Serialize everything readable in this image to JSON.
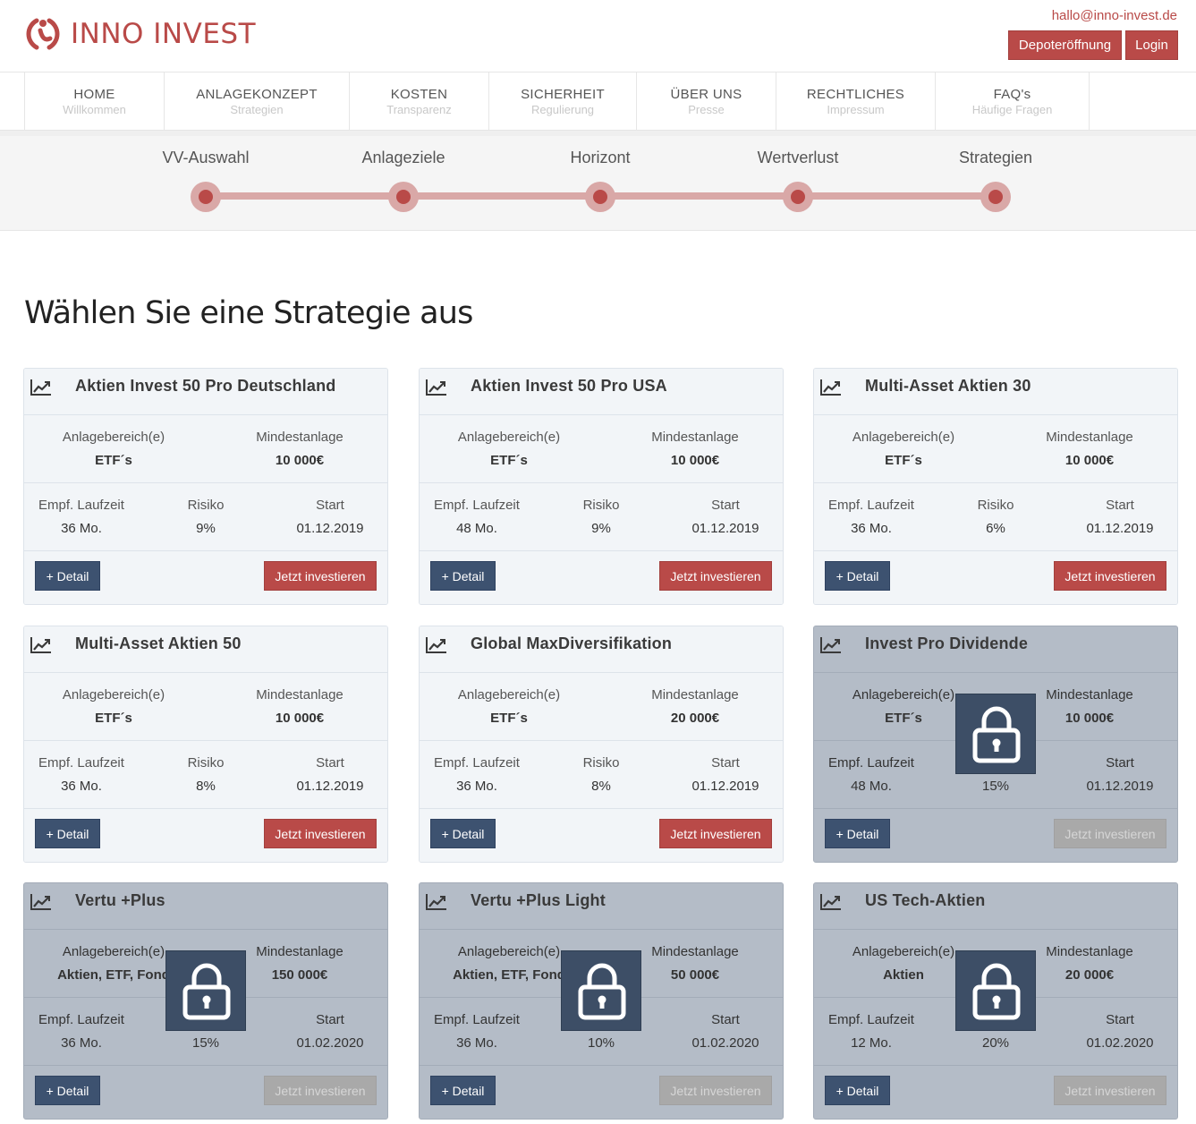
{
  "header": {
    "brand": "INNO INVEST",
    "email": "hallo@inno-invest.de",
    "depot_label": "Depoteröffnung",
    "login_label": "Login",
    "accent": "#b94a48"
  },
  "nav": [
    {
      "label": "HOME",
      "sub": "Willkommen"
    },
    {
      "label": "ANLAGEKONZEPT",
      "sub": "Strategien"
    },
    {
      "label": "KOSTEN",
      "sub": "Transparenz"
    },
    {
      "label": "SICHERHEIT",
      "sub": "Regulierung"
    },
    {
      "label": "ÜBER UNS",
      "sub": "Presse"
    },
    {
      "label": "RECHTLICHES",
      "sub": "Impressum"
    },
    {
      "label": "FAQ's",
      "sub": "Häufige Fragen"
    }
  ],
  "steps": [
    "VV-Auswahl",
    "Anlageziele",
    "Horizont",
    "Wertverlust",
    "Strategien"
  ],
  "page_title": "Wählen Sie eine Strategie aus",
  "labels": {
    "area": "Anlagebereich(e)",
    "min": "Mindestanlage",
    "term": "Empf. Laufzeit",
    "risk": "Risiko",
    "start": "Start",
    "detail": "+ Detail",
    "invest": "Jetzt investieren"
  },
  "strategies": [
    {
      "title": "Aktien Invest 50 Pro Deutschland",
      "area": "ETF´s",
      "min": "10 000€",
      "term": "36 Mo.",
      "risk": "9%",
      "start": "01.12.2019",
      "locked": false
    },
    {
      "title": "Aktien Invest 50 Pro USA",
      "area": "ETF´s",
      "min": "10 000€",
      "term": "48 Mo.",
      "risk": "9%",
      "start": "01.12.2019",
      "locked": false
    },
    {
      "title": "Multi-Asset Aktien 30",
      "area": "ETF´s",
      "min": "10 000€",
      "term": "36 Mo.",
      "risk": "6%",
      "start": "01.12.2019",
      "locked": false
    },
    {
      "title": "Multi-Asset Aktien 50",
      "area": "ETF´s",
      "min": "10 000€",
      "term": "36 Mo.",
      "risk": "8%",
      "start": "01.12.2019",
      "locked": false
    },
    {
      "title": "Global MaxDiversifikation",
      "area": "ETF´s",
      "min": "20 000€",
      "term": "36 Mo.",
      "risk": "8%",
      "start": "01.12.2019",
      "locked": false
    },
    {
      "title": "Invest Pro Dividende",
      "area": "ETF´s",
      "min": "10 000€",
      "term": "48 Mo.",
      "risk": "15%",
      "start": "01.12.2019",
      "locked": true
    },
    {
      "title": "Vertu +Plus",
      "area": "Aktien, ETF, Fond",
      "min": "150 000€",
      "term": "36 Mo.",
      "risk": "15%",
      "start": "01.02.2020",
      "locked": true
    },
    {
      "title": "Vertu +Plus Light",
      "area": "Aktien, ETF, Fond",
      "min": "50 000€",
      "term": "36 Mo.",
      "risk": "10%",
      "start": "01.02.2020",
      "locked": true
    },
    {
      "title": "US Tech-Aktien",
      "area": "Aktien",
      "min": "20 000€",
      "term": "12 Mo.",
      "risk": "20%",
      "start": "01.02.2020",
      "locked": true
    }
  ]
}
